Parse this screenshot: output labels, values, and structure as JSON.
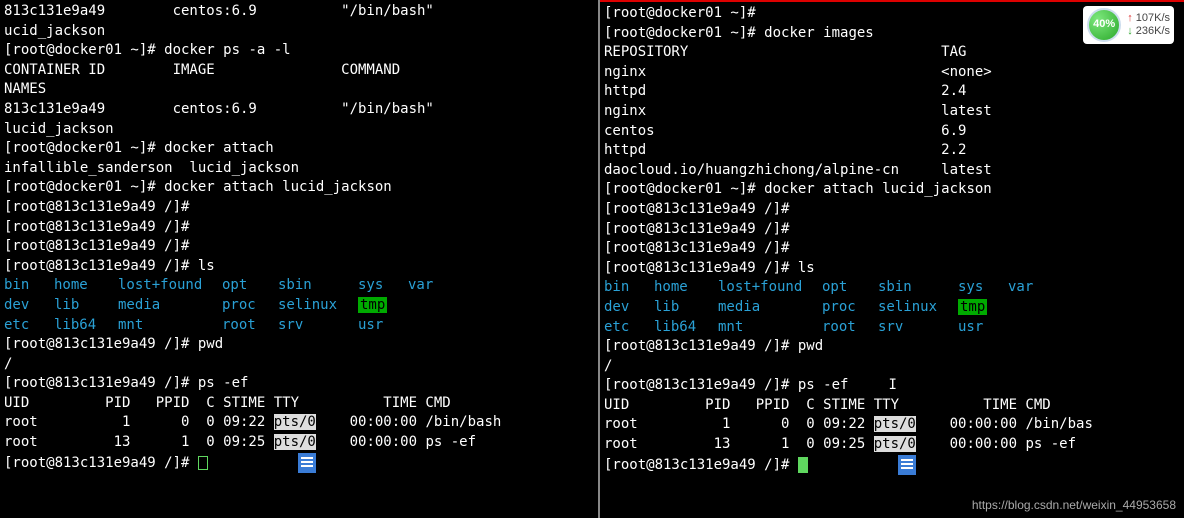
{
  "left": {
    "l1": "813c131e9a49        centos:6.9          \"/bin/bash\"",
    "l2": "ucid_jackson",
    "l3_prompt": "[root@docker01 ~]# ",
    "l3_cmd": "docker ps -a -l",
    "l4": "CONTAINER ID        IMAGE               COMMAND",
    "l5": "NAMES",
    "l6": "813c131e9a49        centos:6.9          \"/bin/bash\"",
    "l7": "lucid_jackson",
    "l8_prompt": "[root@docker01 ~]# ",
    "l8_cmd": "docker attach",
    "l9": "infallible_sanderson  lucid_jackson",
    "l10_prompt": "[root@docker01 ~]# ",
    "l10_cmd": "docker attach lucid_jackson",
    "p11": "[root@813c131e9a49 /]#",
    "p12": "[root@813c131e9a49 /]#",
    "p13": "[root@813c131e9a49 /]#",
    "p14_prompt": "[root@813c131e9a49 /]# ",
    "p14_cmd": "ls",
    "ls_r1": [
      "bin",
      "home",
      "lost+found",
      "opt",
      "sbin",
      "sys",
      "var"
    ],
    "ls_r2": [
      "dev",
      "lib",
      "media",
      "proc",
      "selinux",
      "tmp"
    ],
    "ls_r3": [
      "etc",
      "lib64",
      "mnt",
      "root",
      "srv",
      "usr"
    ],
    "p_pwd_prompt": "[root@813c131e9a49 /]# ",
    "p_pwd_cmd": "pwd",
    "pwd_out": "/",
    "p_ps_prompt": "[root@813c131e9a49 /]# ",
    "p_ps_cmd": "ps -ef",
    "ps_hdr": "UID         PID   PPID  C STIME TTY          TIME CMD",
    "ps_r1a": "root          1      0  0 09:22 ",
    "ps_r1_tty": "pts/0",
    "ps_r1b": "    00:00:00 /bin/bash",
    "ps_r2a": "root         13      1  0 09:25 ",
    "ps_r2_tty": "pts/0",
    "ps_r2b": "    00:00:00 ps -ef",
    "p_last": "[root@813c131e9a49 /]# "
  },
  "right": {
    "r1_prompt": "[root@docker01 ~]#",
    "r2_prompt": "[root@docker01 ~]# ",
    "r2_cmd": "docker images",
    "r3": "REPOSITORY                              TAG",
    "img1": "nginx                                   <none>",
    "img2": "httpd                                   2.4",
    "img3": "nginx                                   latest",
    "img4": "centos                                  6.9",
    "img5": "httpd                                   2.2",
    "img6": "daocloud.io/huangzhichong/alpine-cn     latest",
    "r_attach_prompt": "[root@docker01 ~]# ",
    "r_attach_cmd": "docker attach lucid_jackson",
    "rp1": "[root@813c131e9a49 /]#",
    "rp2": "[root@813c131e9a49 /]#",
    "rp3": "[root@813c131e9a49 /]#",
    "rp_ls_prompt": "[root@813c131e9a49 /]# ",
    "rp_ls_cmd": "ls",
    "ls_r1": [
      "bin",
      "home",
      "lost+found",
      "opt",
      "sbin",
      "sys",
      "var"
    ],
    "ls_r2": [
      "dev",
      "lib",
      "media",
      "proc",
      "selinux",
      "tmp"
    ],
    "ls_r3": [
      "etc",
      "lib64",
      "mnt",
      "root",
      "srv",
      "usr"
    ],
    "rp_pwd_prompt": "[root@813c131e9a49 /]# ",
    "rp_pwd_cmd": "pwd",
    "pwd_out": "/",
    "rp_ps_prompt": "[root@813c131e9a49 /]# ",
    "rp_ps_cmd": "ps -ef",
    "ps_hdr": "UID         PID   PPID  C STIME TTY          TIME CMD",
    "ps_r1a": "root          1      0  0 09:22 ",
    "ps_r1_tty": "pts/0",
    "ps_r1b": "    00:00:00 /bin/bas",
    "ps_r2a": "root         13      1  0 09:25 ",
    "ps_r2_tty": "pts/0",
    "ps_r2b": "    00:00:00 ps -ef",
    "rp_last": "[root@813c131e9a49 /]# "
  },
  "widget": {
    "pct": "40%",
    "up": "107K/s",
    "dn": "236K/s"
  },
  "watermark": "https://blog.csdn.net/weixin_44953658",
  "ls_widths": [
    50,
    64,
    104,
    56,
    80,
    50,
    40
  ]
}
